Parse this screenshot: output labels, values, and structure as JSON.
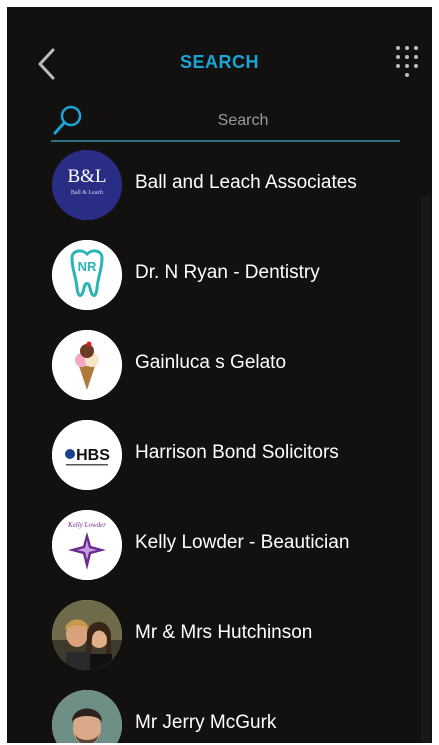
{
  "header": {
    "title": "SEARCH",
    "back_icon": "chevron-left-icon",
    "menu_icon": "grid-dots-icon"
  },
  "search": {
    "placeholder": "Search",
    "value": "",
    "icon": "search-icon"
  },
  "colors": {
    "background": "#121110",
    "accent": "#1aa5d6",
    "underline": "#2f6f82",
    "text": "#ffffff"
  },
  "contacts": [
    {
      "name": "Ball and Leach Associates",
      "avatar": "ball-leach-logo",
      "logo_text": "B&L",
      "logo_subtext": "Ball & Leach"
    },
    {
      "name": "Dr. N Ryan - Dentistry",
      "avatar": "tooth-logo",
      "logo_text": "NR"
    },
    {
      "name": "Gainluca s Gelato",
      "avatar": "ice-cream-logo"
    },
    {
      "name": "Harrison Bond Solicitors",
      "avatar": "hbs-logo",
      "logo_text": "HBS"
    },
    {
      "name": "Kelly Lowder - Beautician",
      "avatar": "sparkle-logo",
      "logo_text": "Kelly Lowder"
    },
    {
      "name": "Mr & Mrs Hutchinson",
      "avatar": "couple-photo"
    },
    {
      "name": "Mr Jerry McGurk",
      "avatar": "man-photo"
    }
  ]
}
